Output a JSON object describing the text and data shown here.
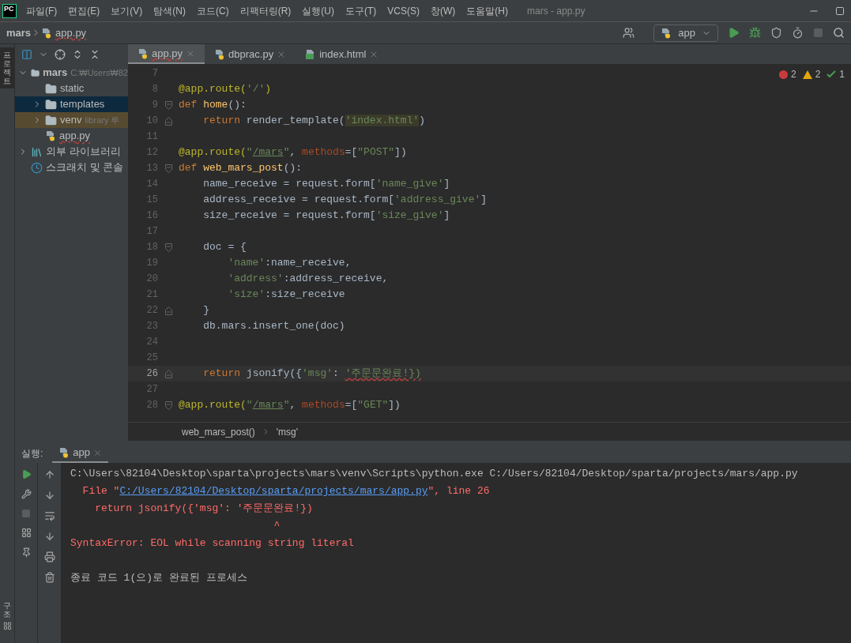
{
  "title_bar": {
    "logo": "PC",
    "menu": [
      "파일(F)",
      "편집(E)",
      "보기(V)",
      "탐색(N)",
      "코드(C)",
      "리팩터링(R)",
      "실행(U)",
      "도구(T)",
      "VCS(S)",
      "창(W)",
      "도움말(H)"
    ],
    "title": "mars - app.py"
  },
  "nav_bar": {
    "breadcrumb": [
      "mars",
      "app.py"
    ],
    "run_config": "app"
  },
  "left_stripe": {
    "top": "프로젝트",
    "bottom": "구조"
  },
  "project_tree": [
    {
      "label": "mars",
      "hint": "C:₩Users₩82",
      "kind": "folder",
      "expanded": true,
      "selected": false,
      "children": [
        {
          "label": "static",
          "kind": "folder",
          "selected": false
        },
        {
          "label": "templates",
          "kind": "folder",
          "expanded": false,
          "selected": true
        },
        {
          "label": "venv",
          "hint": "library 루",
          "kind": "folder",
          "expanded": false,
          "selected": false,
          "excluded": true
        },
        {
          "label": "app.py",
          "kind": "python",
          "selected": false
        }
      ]
    },
    {
      "label": "외부 라이브러리",
      "kind": "library",
      "expanded": false,
      "selected": false
    },
    {
      "label": "스크래치 및 콘솔",
      "kind": "scratch",
      "selected": false
    }
  ],
  "editor_tabs": [
    {
      "label": "app.py",
      "kind": "python",
      "selected": true
    },
    {
      "label": "dbprac.py",
      "kind": "python",
      "selected": false
    },
    {
      "label": "index.html",
      "kind": "html",
      "selected": false
    }
  ],
  "inspections": {
    "errors": "2",
    "warnings": "2",
    "typos": "1"
  },
  "code_lines": [
    {
      "number": "7",
      "current": false
    },
    {
      "number": "8",
      "current": false,
      "tokens": [
        {
          "kind": "decorator",
          "text": "@app.route("
        },
        {
          "kind": "string",
          "text": "'/'"
        },
        {
          "kind": "decorator",
          "text": ")"
        }
      ]
    },
    {
      "number": "9",
      "fold_start": true,
      "current": false,
      "tokens": [
        {
          "kind": "keyword",
          "text": "def "
        },
        {
          "kind": "function",
          "text": "home"
        },
        {
          "kind": "plain",
          "text": "():"
        }
      ]
    },
    {
      "number": "10",
      "fold_end": true,
      "current": false,
      "tokens": [
        {
          "kind": "keyword",
          "text": "    return "
        },
        {
          "kind": "plain",
          "text": "render_template("
        },
        {
          "kind": "string-highlight",
          "text": "'index.html'"
        },
        {
          "kind": "plain",
          "text": ")"
        }
      ]
    },
    {
      "number": "11",
      "current": false
    },
    {
      "number": "12",
      "current": false,
      "tokens": [
        {
          "kind": "decorator",
          "text": "@app.route("
        },
        {
          "kind": "string",
          "text": "\""
        },
        {
          "kind": "string-link",
          "text": "/mars"
        },
        {
          "kind": "string",
          "text": "\""
        },
        {
          "kind": "plain",
          "text": ", "
        },
        {
          "kind": "param",
          "text": "methods"
        },
        {
          "kind": "plain",
          "text": "=["
        },
        {
          "kind": "string",
          "text": "\"POST\""
        },
        {
          "kind": "plain",
          "text": "])"
        }
      ]
    },
    {
      "number": "13",
      "fold_start": true,
      "current": false,
      "tokens": [
        {
          "kind": "keyword",
          "text": "def "
        },
        {
          "kind": "function",
          "text": "web_mars_post"
        },
        {
          "kind": "plain",
          "text": "():"
        }
      ]
    },
    {
      "number": "14",
      "current": false,
      "tokens": [
        {
          "kind": "plain",
          "text": "    name_receive = request.form["
        },
        {
          "kind": "string",
          "text": "'name_give'"
        },
        {
          "kind": "plain",
          "text": "]"
        }
      ]
    },
    {
      "number": "15",
      "current": false,
      "tokens": [
        {
          "kind": "plain",
          "text": "    address_receive = request.form["
        },
        {
          "kind": "string",
          "text": "'address_give'"
        },
        {
          "kind": "plain",
          "text": "]"
        }
      ]
    },
    {
      "number": "16",
      "current": false,
      "tokens": [
        {
          "kind": "plain",
          "text": "    size_receive = request.form["
        },
        {
          "kind": "string",
          "text": "'size_give'"
        },
        {
          "kind": "plain",
          "text": "]"
        }
      ]
    },
    {
      "number": "17",
      "current": false
    },
    {
      "number": "18",
      "fold_start": true,
      "current": false,
      "tokens": [
        {
          "kind": "plain",
          "text": "    doc = {"
        }
      ]
    },
    {
      "number": "19",
      "current": false,
      "tokens": [
        {
          "kind": "string",
          "text": "        'name'"
        },
        {
          "kind": "plain",
          "text": ":name_receive,"
        }
      ]
    },
    {
      "number": "20",
      "current": false,
      "tokens": [
        {
          "kind": "string",
          "text": "        'address'"
        },
        {
          "kind": "plain",
          "text": ":address_receive,"
        }
      ]
    },
    {
      "number": "21",
      "current": false,
      "tokens": [
        {
          "kind": "string",
          "text": "        'size'"
        },
        {
          "kind": "plain",
          "text": ":size_receive"
        }
      ]
    },
    {
      "number": "22",
      "fold_end": true,
      "current": false,
      "tokens": [
        {
          "kind": "plain",
          "text": "    }"
        }
      ]
    },
    {
      "number": "23",
      "current": false,
      "tokens": [
        {
          "kind": "plain",
          "text": "    db.mars.insert_one(doc)"
        }
      ]
    },
    {
      "number": "24",
      "current": false
    },
    {
      "number": "25",
      "current": false
    },
    {
      "number": "26",
      "fold_end": true,
      "current": true,
      "tokens": [
        {
          "kind": "keyword",
          "text": "    return "
        },
        {
          "kind": "plain",
          "text": "jsonify({"
        },
        {
          "kind": "string",
          "text": "'msg'"
        },
        {
          "kind": "plain",
          "text": ": "
        },
        {
          "kind": "string-error",
          "text": "'주문문완료!})"
        }
      ]
    },
    {
      "number": "27",
      "current": false
    },
    {
      "number": "28",
      "fold_start": true,
      "current": false,
      "tokens": [
        {
          "kind": "decorator",
          "text": "@app.route("
        },
        {
          "kind": "string",
          "text": "\""
        },
        {
          "kind": "string-link",
          "text": "/mars"
        },
        {
          "kind": "string",
          "text": "\""
        },
        {
          "kind": "plain",
          "text": ", "
        },
        {
          "kind": "param",
          "text": "methods"
        },
        {
          "kind": "plain",
          "text": "=["
        },
        {
          "kind": "string",
          "text": "\"GET\""
        },
        {
          "kind": "plain",
          "text": "])"
        }
      ]
    }
  ],
  "editor_breadcrumb": [
    "web_mars_post()",
    "'msg'"
  ],
  "run_panel": {
    "label": "실행:",
    "tab": "app",
    "output": [
      {
        "kind": "line",
        "tokens": [
          {
            "kind": "plain",
            "text": "C:\\Users\\82104\\Desktop\\sparta\\projects\\mars\\venv\\Scripts\\python.exe C:/Users/82104/Desktop/sparta/projects/mars/app.py"
          }
        ]
      },
      {
        "kind": "line",
        "tokens": [
          {
            "kind": "error",
            "text": "  File \""
          },
          {
            "kind": "link",
            "text": "C:/Users/82104/Desktop/sparta/projects/mars/app.py"
          },
          {
            "kind": "error",
            "text": "\", line 26"
          }
        ]
      },
      {
        "kind": "line",
        "tokens": [
          {
            "kind": "error",
            "text": "    return jsonify({'msg': '주문문완료!})"
          }
        ]
      },
      {
        "kind": "line",
        "tokens": [
          {
            "kind": "error",
            "text": "                                 ^"
          }
        ]
      },
      {
        "kind": "line",
        "tokens": [
          {
            "kind": "error",
            "text": "SyntaxError: EOL while scanning string literal"
          }
        ]
      },
      {
        "kind": "exit",
        "tokens": [
          {
            "kind": "plain",
            "text": "종료 코드 1(으)로 완료된 프로세스"
          }
        ]
      }
    ]
  }
}
